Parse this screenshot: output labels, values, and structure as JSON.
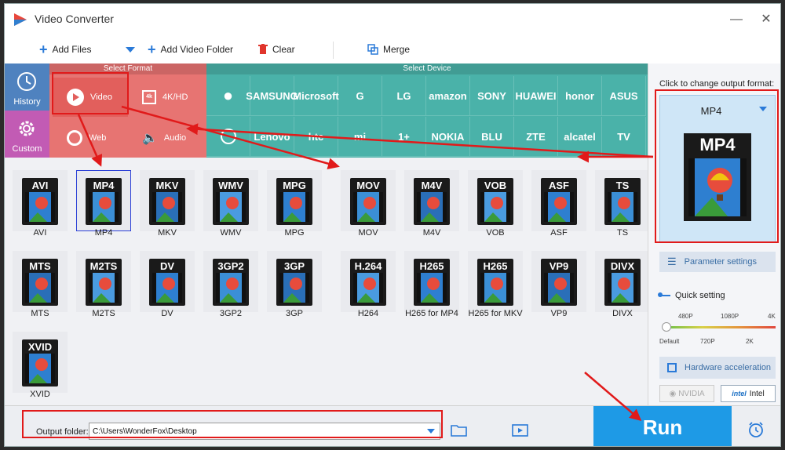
{
  "window": {
    "title": "Video Converter",
    "minimize_icon": "minimize-icon",
    "close_icon": "close-icon"
  },
  "toolbar": {
    "add_files": "Add Files",
    "add_video_folder": "Add Video Folder",
    "clear": "Clear",
    "merge": "Merge"
  },
  "sidebar": {
    "history": "History",
    "custom": "Custom"
  },
  "format_section": {
    "header": "Select Format",
    "categories": [
      {
        "label": "Video",
        "icon": "play-icon"
      },
      {
        "label": "4K/HD",
        "icon": "4k-icon"
      },
      {
        "label": "Web",
        "icon": "chrome-icon"
      },
      {
        "label": "Audio",
        "icon": "speaker-icon"
      }
    ]
  },
  "device_section": {
    "header": "Select Device",
    "row1": [
      "",
      "SAMSUNG",
      "Microsoft",
      "G",
      "LG",
      "amazon",
      "SONY",
      "HUAWEI",
      "honor",
      "ASUS"
    ],
    "row2": [
      "",
      "Lenovo",
      "htc",
      "mi",
      "1+",
      "NOKIA",
      "BLU",
      "ZTE",
      "alcatel",
      "TV"
    ]
  },
  "formats": [
    {
      "label": "AVI",
      "badge": "AVI"
    },
    {
      "label": "MP4",
      "badge": "MP4"
    },
    {
      "label": "MKV",
      "badge": "MKV"
    },
    {
      "label": "WMV",
      "badge": "WMV"
    },
    {
      "label": "MPG",
      "badge": "MPG"
    },
    {
      "label": "MOV",
      "badge": "MOV"
    },
    {
      "label": "M4V",
      "badge": "M4V"
    },
    {
      "label": "VOB",
      "badge": "VOB"
    },
    {
      "label": "ASF",
      "badge": "ASF"
    },
    {
      "label": "TS",
      "badge": "TS"
    },
    {
      "label": "MTS",
      "badge": "MTS"
    },
    {
      "label": "M2TS",
      "badge": "M2TS"
    },
    {
      "label": "DV",
      "badge": "DV"
    },
    {
      "label": "3GP2",
      "badge": "3GP2"
    },
    {
      "label": "3GP",
      "badge": "3GP"
    },
    {
      "label": "H264",
      "badge": "H.264"
    },
    {
      "label": "H265 for MP4",
      "badge": "H265"
    },
    {
      "label": "H265 for MKV",
      "badge": "H265"
    },
    {
      "label": "VP9",
      "badge": "VP9"
    },
    {
      "label": "DIVX",
      "badge": "DIVX"
    },
    {
      "label": "XVID",
      "badge": "XVID"
    }
  ],
  "right_panel": {
    "hint": "Click to change output format:",
    "output_format": "MP4",
    "parameter_settings": "Parameter settings",
    "quick_setting": "Quick setting",
    "quality_top": [
      "480P",
      "1080P",
      "4K"
    ],
    "quality_bottom": [
      "Default",
      "720P",
      "2K"
    ],
    "hardware_acceleration": "Hardware acceleration",
    "nvidia": "NVIDIA",
    "intel": "Intel"
  },
  "bottom": {
    "output_folder_label": "Output folder:",
    "output_folder_value": "C:\\Users\\WonderFox\\Desktop",
    "run": "Run"
  },
  "colors": {
    "format_bg": "#e77472",
    "device_bg": "#4ab2a9",
    "run_bg": "#1e9ae6",
    "annotation_red": "#e11a1a"
  }
}
